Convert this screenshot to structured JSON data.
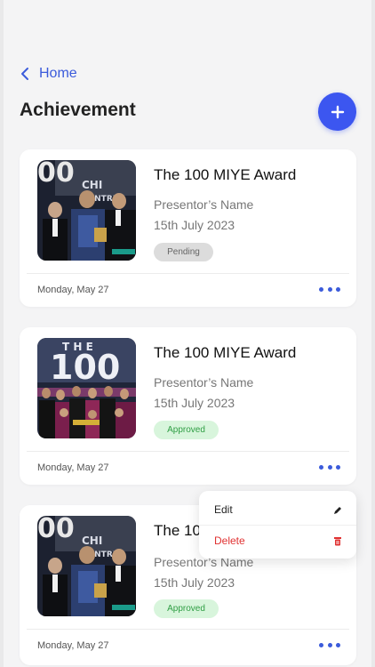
{
  "nav": {
    "back_label": "Home"
  },
  "page": {
    "title": "Achievement"
  },
  "cards": [
    {
      "title": "The 100 MIYE Award",
      "presenter": "Presentor’s Name",
      "date": "15th July 2023",
      "status": "Pending",
      "footer_date": "Monday, May 27",
      "image": "award-photo"
    },
    {
      "title": "The 100 MIYE Award",
      "presenter": "Presentor’s Name",
      "date": "15th July 2023",
      "status": "Approved",
      "footer_date": "Monday, May 27",
      "image": "group-photo"
    },
    {
      "title": "The 10",
      "presenter": "Presentor’s Name",
      "date": "15th July 2023",
      "status": "Approved",
      "footer_date": "Monday, May 27",
      "image": "award-photo"
    }
  ],
  "menu": {
    "edit_label": "Edit",
    "delete_label": "Delete"
  },
  "colors": {
    "accent": "#3c56f0",
    "approved": "#2f9e44",
    "delete": "#e03131"
  }
}
